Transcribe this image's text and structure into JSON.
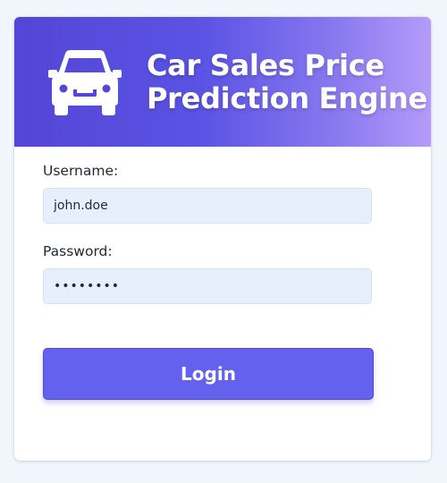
{
  "header": {
    "icon": "car-icon",
    "title_line1": "Car Sales Price",
    "title_line2": "Prediction Engine"
  },
  "form": {
    "username_label": "Username:",
    "username_value": "john.doe",
    "password_label": "Password:",
    "password_value": "••••••••",
    "login_label": "Login"
  },
  "colors": {
    "accent": "#6461ef",
    "header_start": "#5446d6",
    "header_end": "#b59bf9"
  }
}
